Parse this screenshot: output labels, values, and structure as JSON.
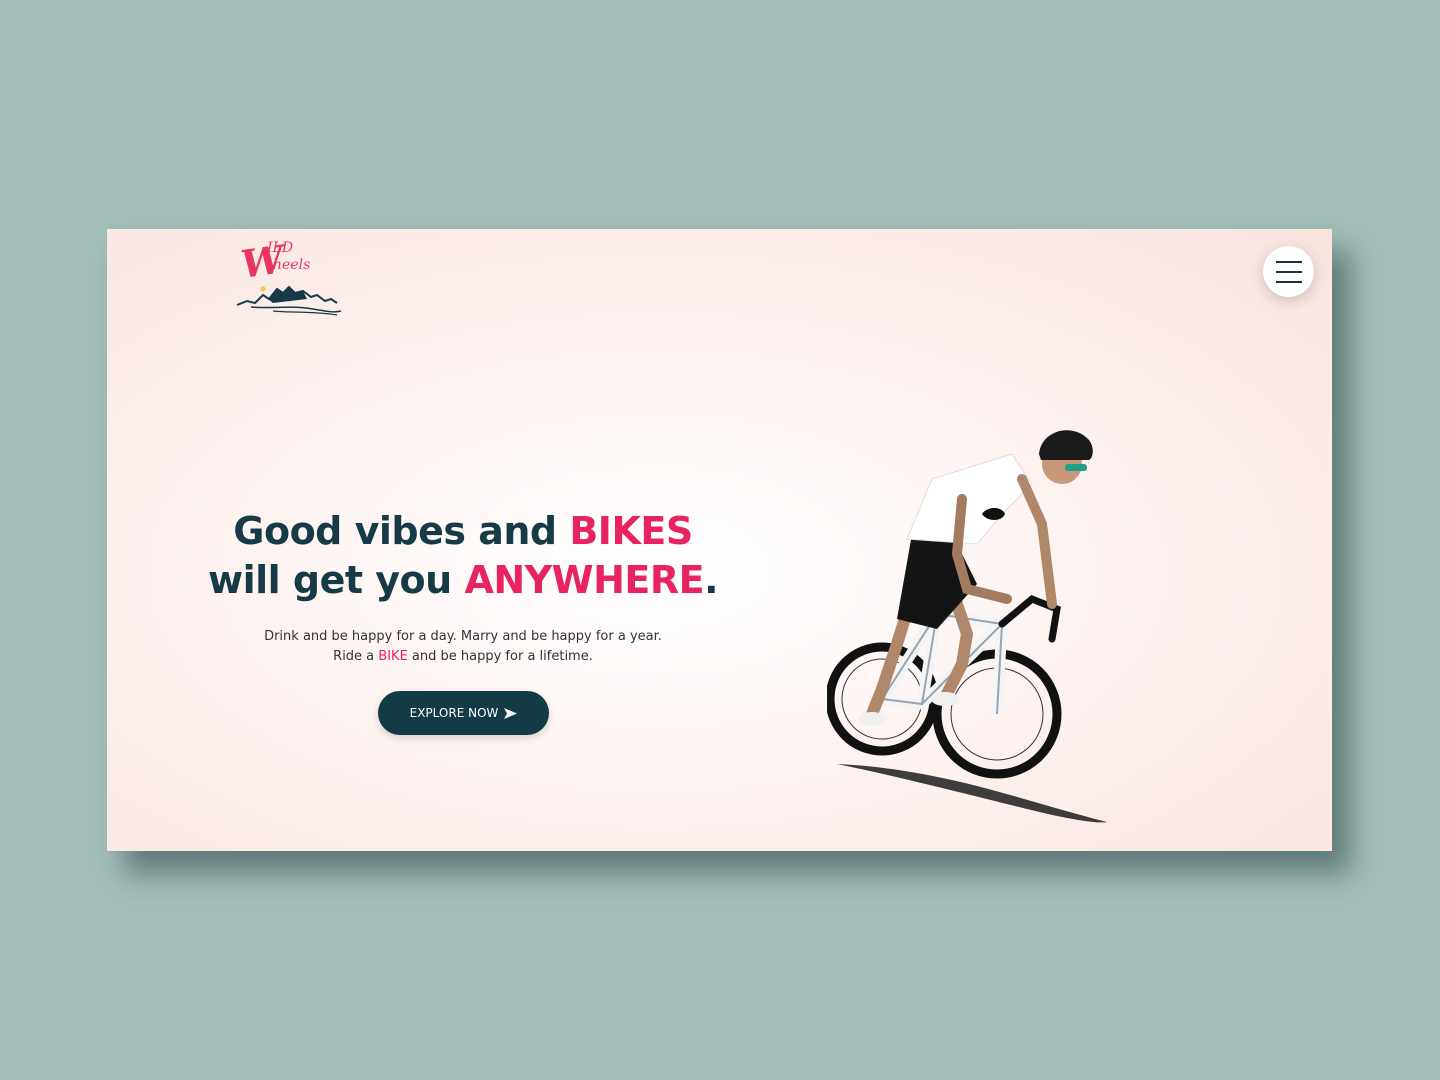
{
  "brand": {
    "logo_w": "W",
    "logo_ild": "ILD",
    "logo_heels": "heels"
  },
  "menu": {
    "icon": "hamburger-menu-icon"
  },
  "hero": {
    "headline_line1_a": "Good vibes and ",
    "headline_line1_b": "BIKES",
    "headline_line2_a": "will get you ",
    "headline_line2_b": "ANYWHERE",
    "headline_line2_c": ".",
    "subtitle_line1": "Drink and be happy for a day. Marry and be happy for a year.",
    "subtitle_line2_a": "Ride a ",
    "subtitle_line2_b": "BIKE",
    "subtitle_line2_c": " and be happy for a lifetime.",
    "cta_label": "EXPLORE NOW",
    "cta_icon": "arrow-right-icon"
  },
  "colors": {
    "accent": "#e8245e",
    "dark": "#133b46",
    "background": "#a3bdb9"
  }
}
